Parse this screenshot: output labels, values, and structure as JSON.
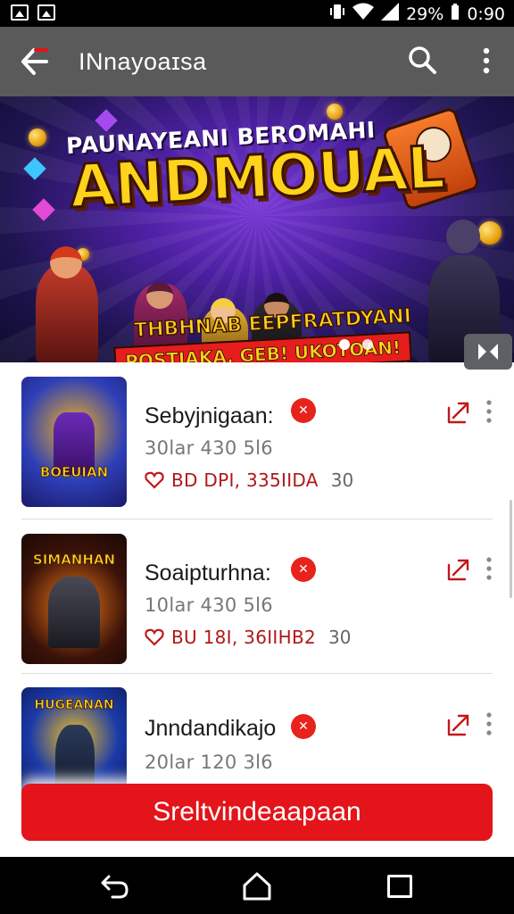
{
  "status_bar": {
    "battery": "29%",
    "time": "0:90",
    "icons": [
      "image-icon",
      "gallery-icon",
      "vibrate-icon",
      "wifi-icon",
      "signal-icon"
    ]
  },
  "app_bar": {
    "title": "INnayoaɪsa",
    "icons": [
      "back-arrow-icon",
      "search-icon",
      "more-vert-icon"
    ]
  },
  "banner": {
    "top_text": "PAUNAYEANI BEROMAHI",
    "main_text": "ANDMOUAL",
    "sub_text_1": "THBHNAB EEPFRATDYANI",
    "sub_text_2": "POSTIAKA, GEB! UKOTOAN!",
    "page_indicator": {
      "count": 2,
      "active": 0
    }
  },
  "items": [
    {
      "title": "Sebyjnigaan:",
      "badge": "✕",
      "subtitle": "30lar 430 5l6",
      "meta": "BD DPI, 335IIDA",
      "count": "30",
      "thumb_text": "BOEUIAN",
      "thumb_colors": [
        "#2e3fb8",
        "#e8b524",
        "#3b1a6b"
      ]
    },
    {
      "title": "Soaipturhna:",
      "badge": "✕",
      "subtitle": "10lar 430 5l6",
      "meta": "BU 18I, 36IIHB2",
      "count": "30",
      "thumb_text": "SIMANHAN",
      "thumb_colors": [
        "#3a1208",
        "#f07a1a",
        "#1a0a05"
      ]
    },
    {
      "title": "Jnndandikajo",
      "badge": "✕",
      "subtitle": "20lar 120 3l6",
      "meta": "",
      "count": "",
      "thumb_text": "HUGEANAN",
      "thumb_colors": [
        "#1b3aa8",
        "#f0c020",
        "#0e1a5a"
      ]
    }
  ],
  "cta": {
    "label": "Sreltvindeaapaan"
  },
  "nav_bar": {
    "icons": [
      "nav-back-icon",
      "nav-home-icon",
      "nav-recents-icon"
    ]
  },
  "colors": {
    "accent": "#e3141a",
    "app_bar": "#5a5a5a",
    "badge": "#e8231b"
  }
}
